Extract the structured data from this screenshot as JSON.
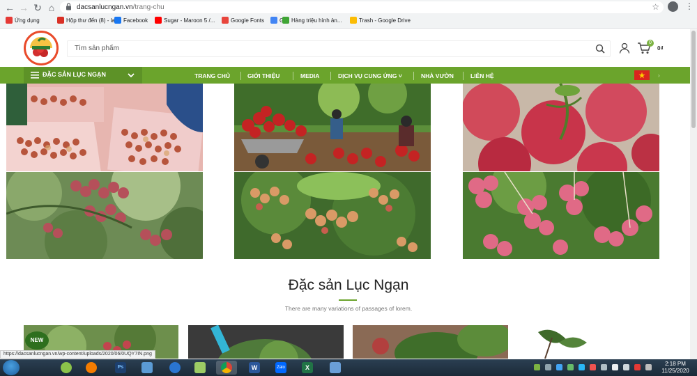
{
  "browser": {
    "url_host": "dacsanlucngan.vn",
    "url_path": "/trang-chu",
    "bookmarks": [
      {
        "label": "Ứng dụng",
        "color": "#e53935"
      },
      {
        "label": "Hộp thư đến (8) - la...",
        "color": "#d93025"
      },
      {
        "label": "Facebook",
        "color": "#1877f2"
      },
      {
        "label": "Sugar - Maroon 5 /...",
        "color": "#ff0000"
      },
      {
        "label": "Google Fonts",
        "color": "#e8453c"
      },
      {
        "label": "G",
        "color": "#4285f4"
      },
      {
        "label": "Hàng triệu hình ản...",
        "color": "#3fa535"
      },
      {
        "label": "Trash - Google Drive",
        "color": "#fbbc04"
      }
    ],
    "status_url": "https://dacsanlucngan.vn/wp-content/uploads/2020/06/0UQY7IN.png"
  },
  "header": {
    "search_placeholder": "Tìm sản phẩm",
    "cart_count": "0",
    "cart_total": "0₫"
  },
  "nav": {
    "category_label": "ĐẶC SẢN LỤC NGẠN",
    "items": [
      "TRANG CHỦ",
      "GIỚI THIỆU",
      "MEDIA",
      "DỊCH VỤ CUNG ỨNG",
      "NHÀ VƯỜN",
      "LIÊN HỆ"
    ]
  },
  "section": {
    "title": "Đặc sản Lục Ngạn",
    "subtitle": "There are many variations of passages of lorem."
  },
  "products": {
    "badge": "NEW"
  },
  "taskbar": {
    "time": "2:18 PM",
    "date": "11/25/2020"
  },
  "colors": {
    "brand_green": "#6ba42c",
    "brand_green_dark": "#5d9227",
    "lychee_red": "#c8102e"
  }
}
